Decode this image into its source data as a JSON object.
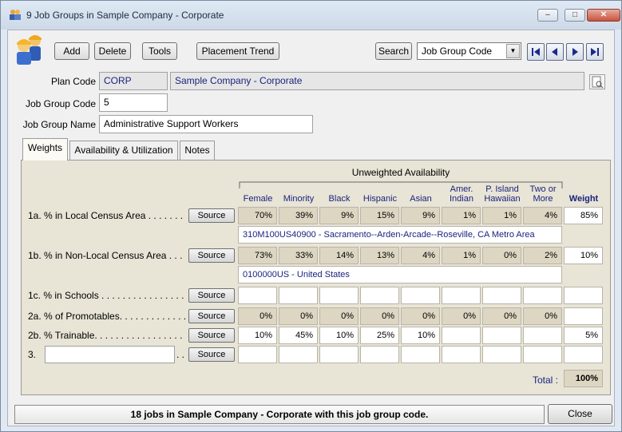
{
  "window": {
    "title": "9 Job Groups in Sample Company - Corporate",
    "icon": "people-icon"
  },
  "toolbar": {
    "add": "Add",
    "delete": "Delete",
    "tools": "Tools",
    "placement_trend": "Placement Trend",
    "search": "Search",
    "search_field": "Job Group Code"
  },
  "form": {
    "plan_code_label": "Plan Code",
    "plan_code": "CORP",
    "plan_name": "Sample Company - Corporate",
    "job_group_code_label": "Job Group Code",
    "job_group_code": "5",
    "job_group_name_label": "Job Group Name",
    "job_group_name": "Administrative Support Workers"
  },
  "tabs": [
    "Weights",
    "Availability & Utilization",
    "Notes"
  ],
  "weights": {
    "group_title": "Unweighted Availability",
    "columns": [
      "Female",
      "Minority",
      "Black",
      "Hispanic",
      "Asian",
      "Amer.\nIndian",
      "P. Island\nHawaiian",
      "Two or\nMore"
    ],
    "weight_col": "Weight",
    "source_label": "Source",
    "rows": [
      {
        "label": "1a.  % in Local Census Area . . . . . . .",
        "values": [
          "70%",
          "39%",
          "9%",
          "15%",
          "9%",
          "1%",
          "1%",
          "4%"
        ],
        "weight": "85%",
        "shaded": true,
        "info": "310M100US40900 - Sacramento--Arden-Arcade--Roseville, CA Metro Area"
      },
      {
        "label": "1b.  % in Non-Local Census Area . . .",
        "values": [
          "73%",
          "33%",
          "14%",
          "13%",
          "4%",
          "1%",
          "0%",
          "2%"
        ],
        "weight": "10%",
        "shaded": true,
        "info": "0100000US - United States"
      },
      {
        "label": "1c.  % in Schools . . . . . . . . . . . . . . . .",
        "values": [
          "",
          "",
          "",
          "",
          "",
          "",
          "",
          ""
        ],
        "weight": "",
        "shaded": false
      },
      {
        "label": "2a.  % of Promotables. . . . . . . . . . . . .",
        "values": [
          "0%",
          "0%",
          "0%",
          "0%",
          "0%",
          "0%",
          "0%",
          "0%"
        ],
        "weight": "",
        "shaded": true
      },
      {
        "label": "2b.  % Trainable. . . . . . . . . . . . . . . . .",
        "values": [
          "10%",
          "45%",
          "10%",
          "25%",
          "10%",
          "",
          "",
          ""
        ],
        "weight": "5%",
        "shaded": false
      },
      {
        "label": "3.",
        "values": [
          "",
          "",
          "",
          "",
          "",
          "",
          "",
          ""
        ],
        "weight": "",
        "shaded": false
      }
    ],
    "total_label": "Total :",
    "total": "100%"
  },
  "status": "18 jobs in Sample Company - Corporate with this job group code.",
  "close_label": "Close"
}
